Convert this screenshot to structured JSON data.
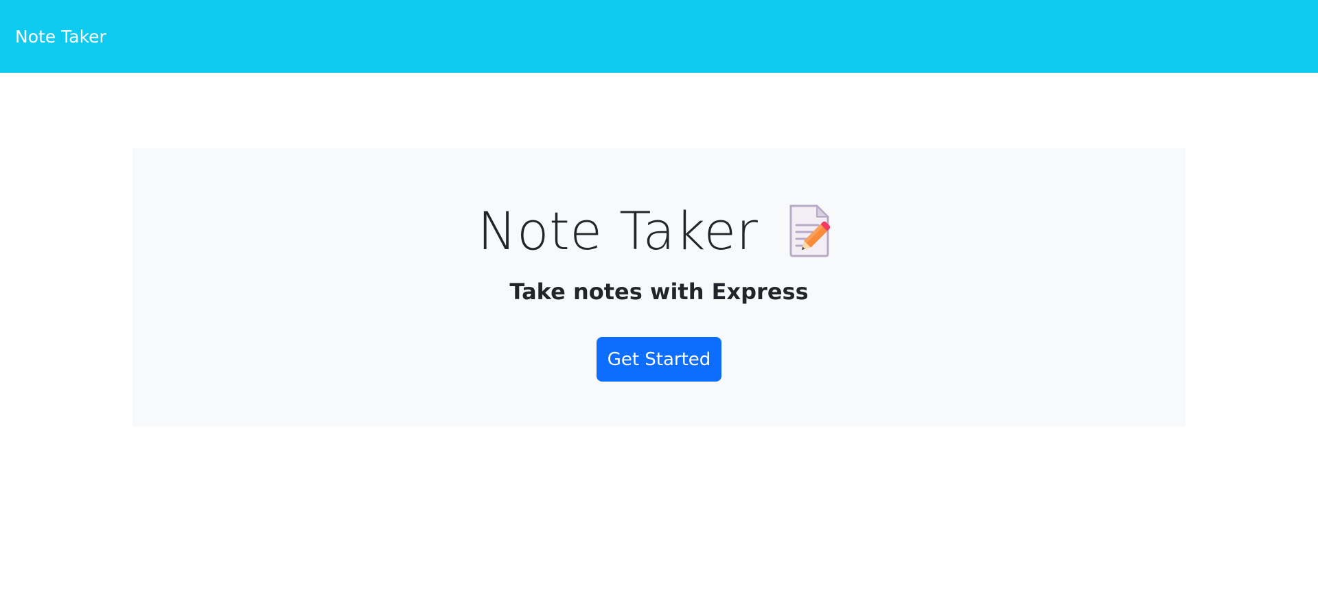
{
  "navbar": {
    "brand": "Note Taker",
    "background": "#0dcaf0"
  },
  "hero": {
    "title": "Note Taker",
    "icon": "memo-icon",
    "subtitle": "Take notes with Express",
    "button_label": "Get Started",
    "button_color": "#0d6efd",
    "background": "#f8f9fa"
  }
}
